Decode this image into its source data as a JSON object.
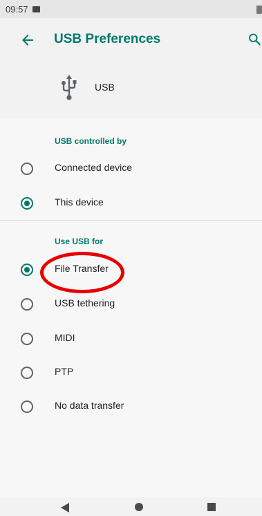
{
  "status_bar": {
    "time": "09:57",
    "notification_icon": "image-icon",
    "battery_icon": "battery-icon"
  },
  "app_bar": {
    "title": "USB Preferences",
    "back_icon": "arrow-back-icon",
    "search_icon": "search-icon"
  },
  "usb_header": {
    "icon": "usb-icon",
    "label": "USB"
  },
  "controlled_by": {
    "title": "USB controlled by",
    "options": [
      {
        "label": "Connected device",
        "selected": false
      },
      {
        "label": "This device",
        "selected": true
      }
    ]
  },
  "use_for": {
    "title": "Use USB for",
    "options": [
      {
        "label": "File Transfer",
        "selected": true
      },
      {
        "label": "USB tethering",
        "selected": false
      },
      {
        "label": "MIDI",
        "selected": false
      },
      {
        "label": "PTP",
        "selected": false
      },
      {
        "label": "No data transfer",
        "selected": false
      }
    ]
  },
  "colors": {
    "accent": "#00796b",
    "highlight": "#e60000",
    "header_background": "#f2f2f2",
    "content_background": "#f7f7f7"
  }
}
